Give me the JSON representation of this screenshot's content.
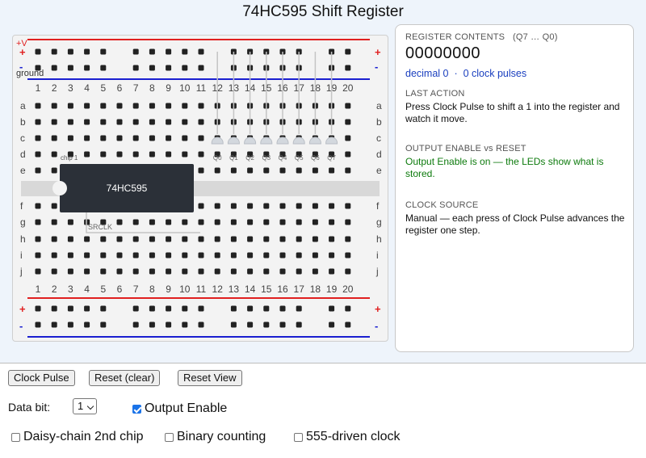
{
  "title": "74HC595 Shift Register",
  "breadboard": {
    "plus_label": "+V",
    "plus_sign": "+",
    "minus_sign": "-",
    "ground_label": "ground",
    "columns": [
      "1",
      "2",
      "3",
      "4",
      "5",
      "6",
      "7",
      "8",
      "9",
      "10",
      "11",
      "12",
      "13",
      "14",
      "15",
      "16",
      "17",
      "18",
      "19",
      "20"
    ],
    "rows_top": [
      "a",
      "b",
      "c",
      "d",
      "e"
    ],
    "rows_bottom": [
      "f",
      "g",
      "h",
      "i",
      "j"
    ],
    "chip_tag": "chip 1",
    "chip_name": "74HC595",
    "srclk_label": "SRCLK",
    "led_labels": [
      "Q0",
      "Q1",
      "Q2",
      "Q3",
      "Q4",
      "Q5",
      "Q6",
      "Q7"
    ],
    "led_states": [
      0,
      0,
      0,
      0,
      0,
      0,
      0,
      0
    ],
    "rail_plus_color": "#e02020",
    "rail_minus_color": "#1a1fd0"
  },
  "panel": {
    "register_heading": "REGISTER CONTENTS",
    "register_range": "(Q7 … Q0)",
    "register_value": "00000000",
    "decimal_text": "decimal 0",
    "separator": "·",
    "pulses_text": "0 clock pulses",
    "last_action_heading": "LAST ACTION",
    "last_action_text": "Press Clock Pulse to shift a 1 into the register and watch it move.",
    "oe_heading": "OUTPUT ENABLE vs RESET",
    "oe_text": "Output Enable is on — the LEDs show what is stored.",
    "clock_heading": "CLOCK SOURCE",
    "clock_text": "Manual — each press of Clock Pulse advances the register one step."
  },
  "controls": {
    "clock_pulse": "Clock Pulse",
    "reset_clear": "Reset (clear)",
    "reset_view": "Reset View",
    "data_bit_label": "Data bit:",
    "data_bit_value": "1",
    "output_enable": "Output Enable",
    "output_enable_checked": true,
    "daisy_chain": "Daisy-chain 2nd chip",
    "binary_counting": "Binary counting",
    "clock555": "555-driven clock"
  }
}
